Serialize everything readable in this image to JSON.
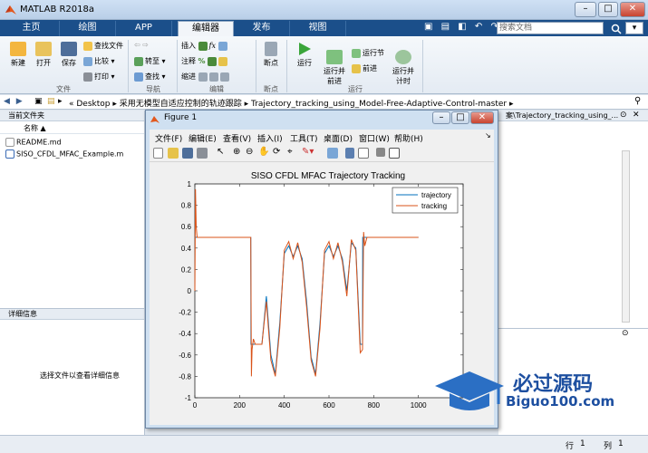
{
  "window": {
    "title": "MATLAB R2018a"
  },
  "tabs": [
    "主页",
    "绘图",
    "APP",
    "编辑器",
    "发布",
    "视图"
  ],
  "search": {
    "placeholder": "搜索文档"
  },
  "ribbon": {
    "file": {
      "new": "新建",
      "open": "打开",
      "save": "保存",
      "find_files": "查找文件",
      "compare": "比较",
      "print": "打印",
      "group": "文件"
    },
    "nav": {
      "goto": "转至",
      "find": "查找",
      "group": "导航"
    },
    "edit": {
      "insert": "插入",
      "comment": "注释",
      "indent": "缩进",
      "group": "编辑"
    },
    "breakpoints": {
      "label": "断点",
      "group": "断点"
    },
    "run": {
      "run": "运行",
      "run_advance": "运行并\n前进",
      "run_section": "运行节",
      "advance": "前进",
      "run_time": "运行并\n计时",
      "group": "运行"
    }
  },
  "address": {
    "path": [
      "Desktop",
      "采用无模型自适应控制的轨迹跟踪",
      "Trajectory_tracking_using_Model-Free-Adaptive-Control-master"
    ]
  },
  "current_folder": {
    "title": "当前文件夹",
    "col_name": "名称",
    "files": [
      "README.md",
      "SISO_CFDL_MFAC_Example.m"
    ]
  },
  "details": {
    "title": "详细信息",
    "hint": "选择文件以查看详细信息"
  },
  "right_panel": {
    "breadcrumb": "案\\Trajectory_tracking_using_..."
  },
  "status": {
    "row_label": "行",
    "row": "1",
    "col_label": "列",
    "col": "1"
  },
  "figure": {
    "title": "Figure 1",
    "menu": [
      "文件(F)",
      "编辑(E)",
      "查看(V)",
      "插入(I)",
      "工具(T)",
      "桌面(D)",
      "窗口(W)",
      "帮助(H)"
    ]
  },
  "watermark": {
    "text": "必过源码",
    "url": "Biguo100.com"
  },
  "colors": {
    "trajectory": "#0072bd",
    "tracking": "#d95319",
    "tabstrip": "#1b4f8a"
  },
  "chart_data": {
    "type": "line",
    "title": "SISO CFDL MFAC Trajectory Tracking",
    "xlabel": "",
    "ylabel": "",
    "xlim": [
      0,
      1200
    ],
    "ylim": [
      -1,
      1
    ],
    "xticks": [
      0,
      200,
      400,
      600,
      800,
      1000,
      1200
    ],
    "yticks": [
      -1,
      -0.8,
      -0.6,
      -0.4,
      -0.2,
      0,
      0.2,
      0.4,
      0.6,
      0.8,
      1
    ],
    "legend": "top-right",
    "series": [
      {
        "name": "trajectory",
        "x": [
          0,
          250,
          251,
          300,
          320,
          340,
          360,
          380,
          400,
          420,
          440,
          460,
          480,
          500,
          520,
          540,
          560,
          580,
          600,
          620,
          640,
          660,
          680,
          700,
          720,
          740,
          750,
          751,
          1000
        ],
        "y": [
          0.5,
          0.5,
          -0.5,
          -0.5,
          -0.05,
          -0.6,
          -0.78,
          -0.3,
          0.35,
          0.42,
          0.32,
          0.42,
          0.3,
          -0.1,
          -0.62,
          -0.78,
          -0.3,
          0.35,
          0.42,
          0.32,
          0.42,
          0.3,
          0.0,
          0.45,
          0.4,
          -0.5,
          -0.5,
          0.5,
          0.5
        ]
      },
      {
        "name": "tracking",
        "x": [
          0,
          3,
          6,
          10,
          15,
          250,
          253,
          256,
          262,
          270,
          300,
          320,
          340,
          360,
          380,
          400,
          420,
          440,
          460,
          480,
          500,
          520,
          540,
          560,
          580,
          600,
          620,
          640,
          660,
          680,
          700,
          720,
          740,
          750,
          755,
          760,
          770,
          1000
        ],
        "y": [
          0,
          0.95,
          0.6,
          0.5,
          0.5,
          0.5,
          -0.8,
          -0.55,
          -0.45,
          -0.5,
          -0.5,
          -0.1,
          -0.65,
          -0.8,
          -0.35,
          0.38,
          0.46,
          0.3,
          0.45,
          0.27,
          -0.15,
          -0.65,
          -0.8,
          -0.35,
          0.38,
          0.46,
          0.3,
          0.45,
          0.27,
          -0.05,
          0.48,
          0.38,
          -0.58,
          -0.55,
          0.55,
          0.42,
          0.5,
          0.5
        ]
      }
    ]
  }
}
